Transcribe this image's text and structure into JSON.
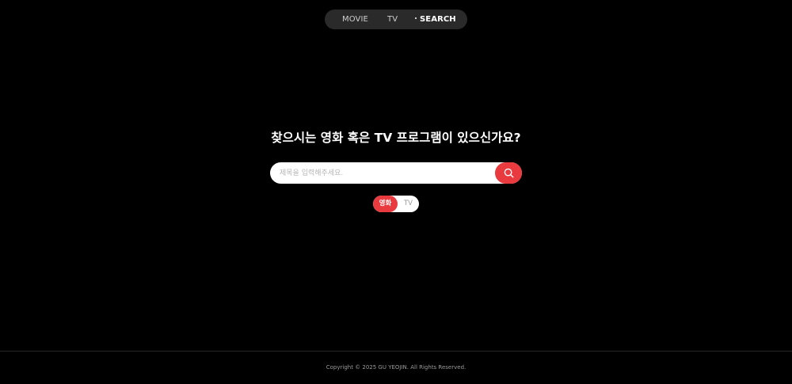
{
  "nav": {
    "items": [
      {
        "label": "MOVIE",
        "active": false
      },
      {
        "label": "TV",
        "active": false
      },
      {
        "label": "SEARCH",
        "active": true
      }
    ]
  },
  "main": {
    "headline": "찾으시는 영화 혹은 TV 프로그램이 있으신가요?",
    "search": {
      "placeholder": "제목을 입력해주세요.",
      "value": "",
      "button_icon": "search-icon"
    },
    "type_toggle": {
      "options": [
        "영화",
        "TV"
      ],
      "selected": "영화"
    }
  },
  "footer": {
    "copyright": "Copyright © 2025 GU YEOJIN. All Rights Reserved."
  },
  "colors": {
    "background": "#000000",
    "accent": "#e83a3f",
    "nav_bg": "#2a2a2a"
  }
}
